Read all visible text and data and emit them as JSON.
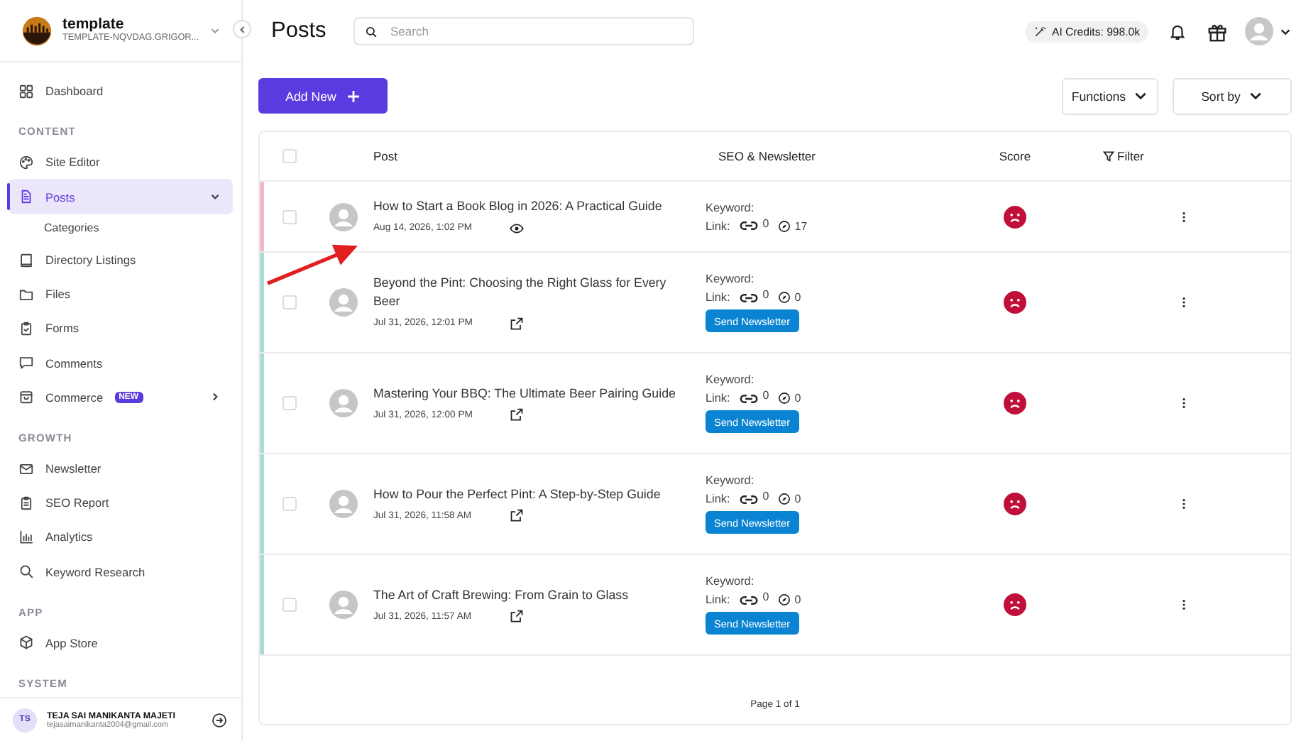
{
  "sidebar": {
    "workspace": {
      "name": "template",
      "domain": "TEMPLATE-NQVDAG.GRIGOR..."
    },
    "sections": [
      {
        "items": [
          {
            "label": "Dashboard",
            "kind": "link",
            "selected": false
          }
        ]
      },
      {
        "heading": "CONTENT",
        "items": [
          {
            "label": "Site Editor",
            "kind": "link",
            "selected": false
          },
          {
            "label": "Posts",
            "kind": "group",
            "selected": true,
            "expanded": true,
            "children": [
              {
                "label": "Categories",
                "selected": false
              }
            ]
          },
          {
            "label": "Directory Listings",
            "kind": "link",
            "selected": false
          },
          {
            "label": "Files",
            "kind": "link",
            "selected": false
          },
          {
            "label": "Forms",
            "kind": "link",
            "selected": false
          },
          {
            "label": "Comments",
            "kind": "link",
            "selected": false
          },
          {
            "label": "Commerce",
            "kind": "group",
            "selected": false,
            "expanded": false,
            "badge": "NEW"
          }
        ]
      },
      {
        "heading": "GROWTH",
        "items": [
          {
            "label": "Newsletter",
            "kind": "link",
            "selected": false
          },
          {
            "label": "SEO Report",
            "kind": "link",
            "selected": false
          },
          {
            "label": "Analytics",
            "kind": "link",
            "selected": false
          },
          {
            "label": "Keyword Research",
            "kind": "link",
            "selected": false
          }
        ]
      },
      {
        "heading": "APP",
        "items": [
          {
            "label": "App Store",
            "kind": "link",
            "selected": false
          }
        ]
      },
      {
        "heading": "SYSTEM"
      }
    ],
    "user": {
      "initials": "TS",
      "name": "TEJA SAI MANIKANTA MAJETI",
      "email": "tejasaimanikanta2004@gmail.com"
    }
  },
  "header": {
    "title": "Posts",
    "search": {
      "placeholder": "Search"
    },
    "ai_credits": "AI Credits: 998.0k"
  },
  "toolbar": {
    "add_button": "Add New",
    "menus": [
      "Functions",
      "Sort by"
    ]
  },
  "table": {
    "all_selected": false,
    "columns": [
      "Post",
      "SEO & Newsletter",
      "Score",
      "Filter"
    ],
    "rows": [
      {
        "selected": false,
        "color": "#f2b8c9",
        "title": "How to Start a Book Blog in 2026: A Practical Guide",
        "date": "Aug 14, 2026, 1:02 PM",
        "kind": "preview",
        "keyword_label": "Keyword:",
        "link_label": "Link:",
        "internal_links": "0",
        "external_links": "17"
      },
      {
        "selected": false,
        "color": "#a9ddd5",
        "title": "Beyond the Pint: Choosing the Right Glass for Every Beer",
        "date": "Jul 31, 2026, 12:01 PM",
        "kind": "published",
        "keyword_label": "Keyword:",
        "link_label": "Link:",
        "internal_links": "0",
        "external_links": "0",
        "newsletter_button": "Send Newsletter"
      },
      {
        "selected": false,
        "color": "#a9ddd5",
        "title": "Mastering Your BBQ: The Ultimate Beer Pairing Guide",
        "date": "Jul 31, 2026, 12:00 PM",
        "kind": "published",
        "keyword_label": "Keyword:",
        "link_label": "Link:",
        "internal_links": "0",
        "external_links": "0",
        "newsletter_button": "Send Newsletter"
      },
      {
        "selected": false,
        "color": "#a9ddd5",
        "title": "How to Pour the Perfect Pint: A Step-by-Step Guide",
        "date": "Jul 31, 2026, 11:58 AM",
        "kind": "published",
        "keyword_label": "Keyword:",
        "link_label": "Link:",
        "internal_links": "0",
        "external_links": "0",
        "newsletter_button": "Send Newsletter"
      },
      {
        "selected": false,
        "color": "#a9ddd5",
        "title": "The Art of Craft Brewing: From Grain to Glass",
        "date": "Jul 31, 2026, 11:57 AM",
        "kind": "published",
        "keyword_label": "Keyword:",
        "link_label": "Link:",
        "internal_links": "0",
        "external_links": "0",
        "newsletter_button": "Send Newsletter"
      }
    ],
    "pagination": "Page 1 of 1"
  }
}
